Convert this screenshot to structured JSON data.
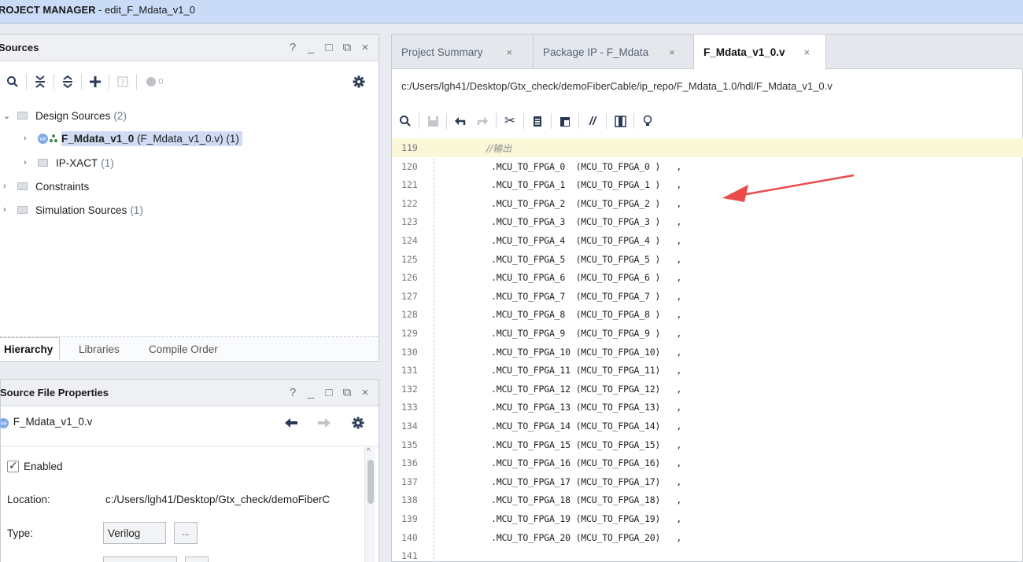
{
  "window": {
    "title_bold": "ROJECT MANAGER",
    "title_rest": " - edit_F_Mdata_v1_0"
  },
  "sources_panel": {
    "title": "Sources",
    "controls": [
      "?",
      "_",
      "□",
      "⧉",
      "×"
    ],
    "toolbar_badge": "0",
    "tree": [
      {
        "label": "Design Sources",
        "count": "(2)"
      },
      {
        "label": "F_Mdata_v1_0",
        "label_rest": " (F_Mdata_v1_0.v) (1)"
      },
      {
        "label": "IP-XACT",
        "count": "(1)"
      },
      {
        "label": "Constraints"
      },
      {
        "label": "Simulation Sources",
        "count": "(1)"
      }
    ],
    "tabs": [
      "Hierarchy",
      "Libraries",
      "Compile Order"
    ]
  },
  "file_properties": {
    "title": "Source File Properties",
    "controls": [
      "?",
      "_",
      "□",
      "⧉",
      "×"
    ],
    "file_name": "F_Mdata_v1_0.v",
    "enabled_label": "Enabled",
    "location_label": "Location:",
    "location_value": "c:/Users/lgh41/Desktop/Gtx_check/demoFiberC",
    "type_label": "Type:",
    "type_value": "Verilog",
    "more_button": "..."
  },
  "editor": {
    "tabs": [
      {
        "label": "Project Summary"
      },
      {
        "label": "Package IP - F_Mdata"
      },
      {
        "label": "F_Mdata_v1_0.v"
      }
    ],
    "path": "c:/Users/lgh41/Desktop/Gtx_check/demoFiberCable/ip_repo/F_Mdata_1.0/hdl/F_Mdata_v1_0.v",
    "lines": [
      {
        "n": "119",
        "comment": "//输出"
      },
      {
        "n": "120",
        "code": ".MCU_TO_FPGA_0  (MCU_TO_FPGA_0 )   ,"
      },
      {
        "n": "121",
        "code": ".MCU_TO_FPGA_1  (MCU_TO_FPGA_1 )   ,"
      },
      {
        "n": "122",
        "code": ".MCU_TO_FPGA_2  (MCU_TO_FPGA_2 )   ,"
      },
      {
        "n": "123",
        "code": ".MCU_TO_FPGA_3  (MCU_TO_FPGA_3 )   ,"
      },
      {
        "n": "124",
        "code": ".MCU_TO_FPGA_4  (MCU_TO_FPGA_4 )   ,"
      },
      {
        "n": "125",
        "code": ".MCU_TO_FPGA_5  (MCU_TO_FPGA_5 )   ,"
      },
      {
        "n": "126",
        "code": ".MCU_TO_FPGA_6  (MCU_TO_FPGA_6 )   ,"
      },
      {
        "n": "127",
        "code": ".MCU_TO_FPGA_7  (MCU_TO_FPGA_7 )   ,"
      },
      {
        "n": "128",
        "code": ".MCU_TO_FPGA_8  (MCU_TO_FPGA_8 )   ,"
      },
      {
        "n": "129",
        "code": ".MCU_TO_FPGA_9  (MCU_TO_FPGA_9 )   ,"
      },
      {
        "n": "130",
        "code": ".MCU_TO_FPGA_10 (MCU_TO_FPGA_10)   ,"
      },
      {
        "n": "131",
        "code": ".MCU_TO_FPGA_11 (MCU_TO_FPGA_11)   ,"
      },
      {
        "n": "132",
        "code": ".MCU_TO_FPGA_12 (MCU_TO_FPGA_12)   ,"
      },
      {
        "n": "133",
        "code": ".MCU_TO_FPGA_13 (MCU_TO_FPGA_13)   ,"
      },
      {
        "n": "134",
        "code": ".MCU_TO_FPGA_14 (MCU_TO_FPGA_14)   ,"
      },
      {
        "n": "135",
        "code": ".MCU_TO_FPGA_15 (MCU_TO_FPGA_15)   ,"
      },
      {
        "n": "136",
        "code": ".MCU_TO_FPGA_16 (MCU_TO_FPGA_16)   ,"
      },
      {
        "n": "137",
        "code": ".MCU_TO_FPGA_17 (MCU_TO_FPGA_17)   ,"
      },
      {
        "n": "138",
        "code": ".MCU_TO_FPGA_18 (MCU_TO_FPGA_18)   ,"
      },
      {
        "n": "139",
        "code": ".MCU_TO_FPGA_19 (MCU_TO_FPGA_19)   ,"
      },
      {
        "n": "140",
        "code": ".MCU_TO_FPGA_20 (MCU_TO_FPGA_20)   ,"
      },
      {
        "n": "141",
        "code": ""
      }
    ]
  },
  "colors": {
    "title_bar": "#c9dbf6",
    "selection": "#cfdcf3",
    "annotation_arrow": "#ec4b4b",
    "highlight_line": "#fbf8d8"
  }
}
